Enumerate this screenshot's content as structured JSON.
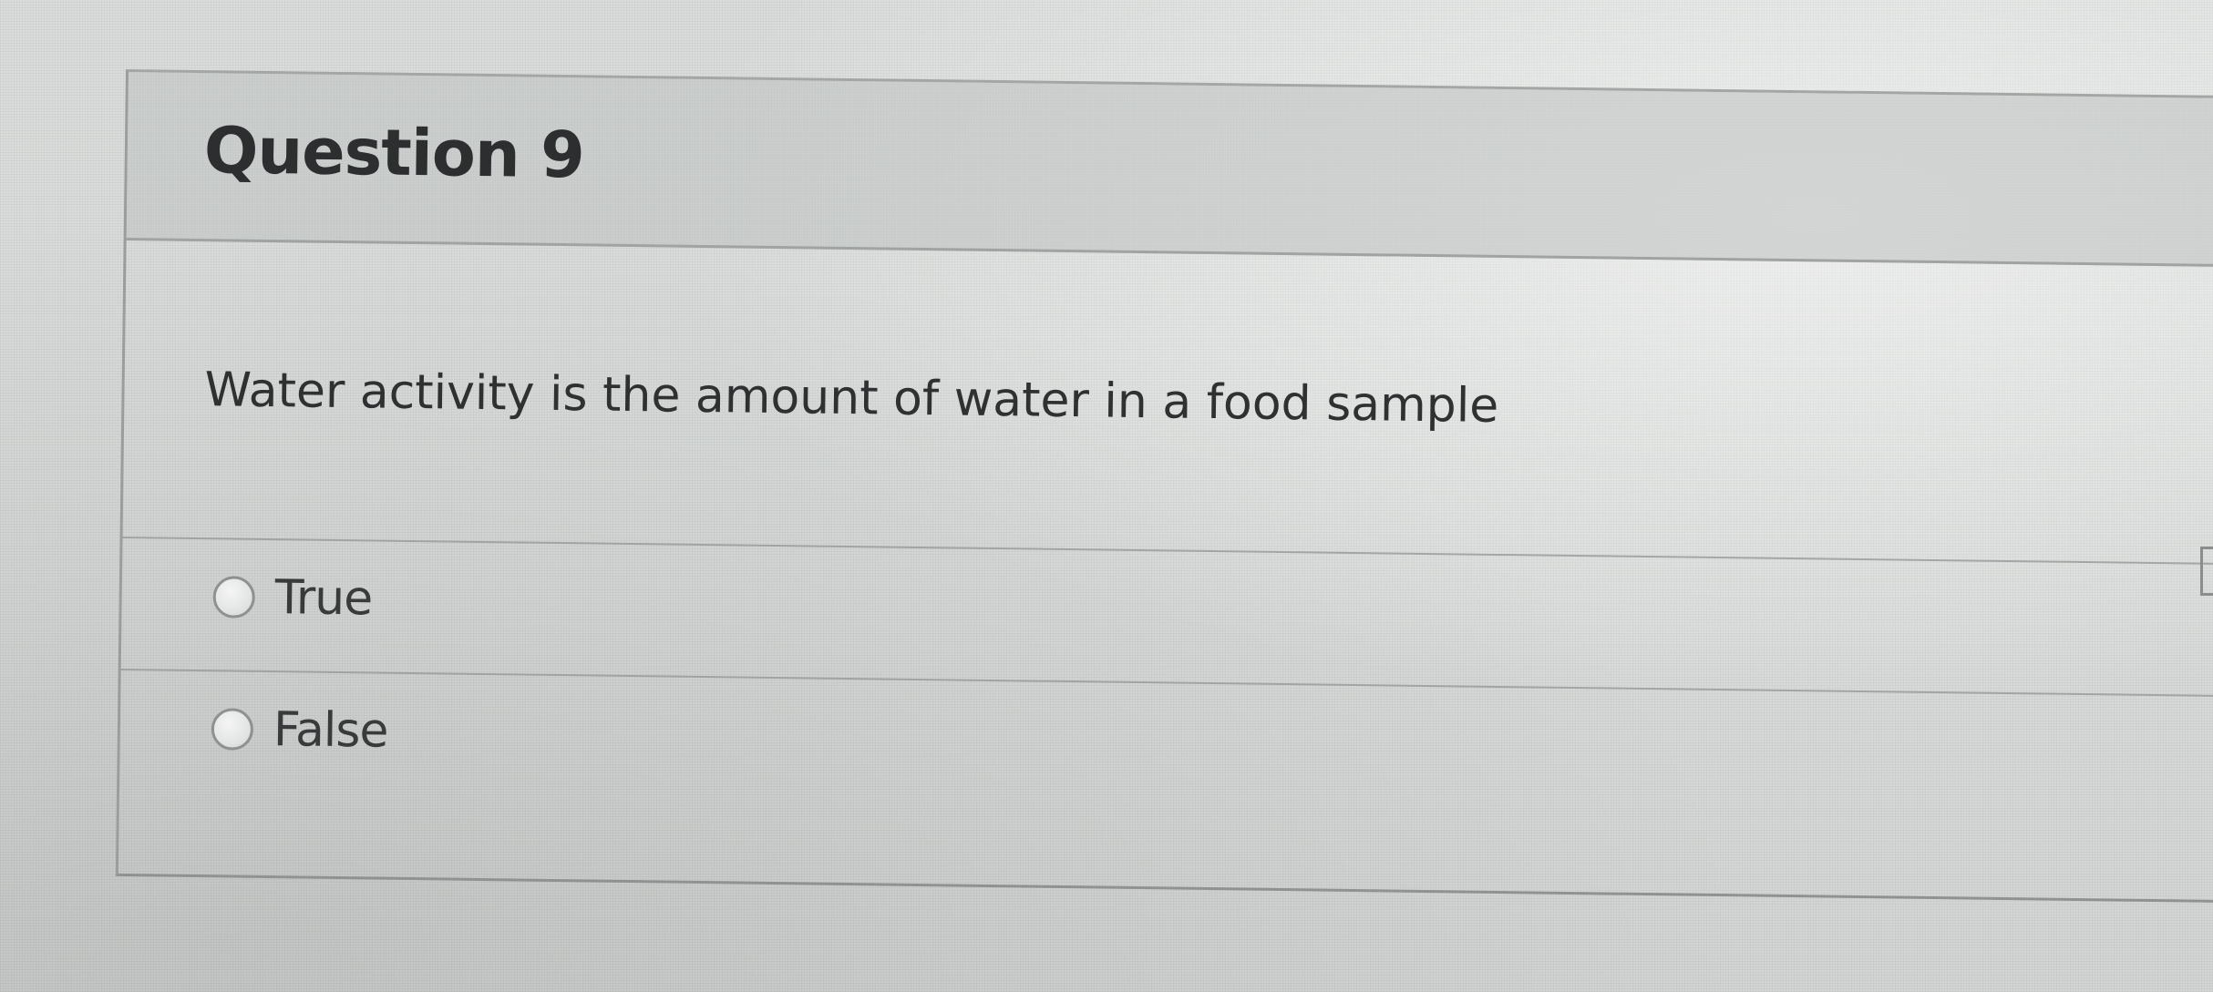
{
  "question": {
    "title": "Question 9",
    "text": "Water activity is the amount of water in a food sample",
    "answers": [
      {
        "label": "True",
        "selected": false
      },
      {
        "label": "False",
        "selected": false
      }
    ]
  },
  "icons": {
    "radio_unselected": "radio-unselected-icon"
  }
}
